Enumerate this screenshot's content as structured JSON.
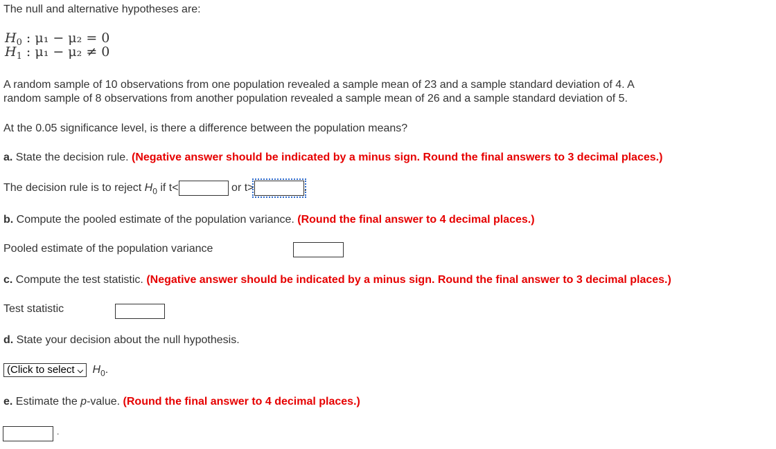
{
  "intro": "The null and alternative hypotheses are:",
  "h0": {
    "label": "H",
    "sub": "0",
    "expr": ": μ₁ − μ₂ = 0"
  },
  "h1": {
    "label": "H",
    "sub": "1",
    "expr": ": μ₁ − μ₂ ≠ 0"
  },
  "problem_line1": "A random sample of 10 observations from one population revealed a sample mean of 23 and a sample standard deviation of 4. A",
  "problem_line2": "random sample of 8 observations from another population revealed a sample mean of 26 and a sample standard deviation of 5.",
  "question": "At the 0.05 significance level, is there a difference between the population means?",
  "part_a": {
    "letter": "a.",
    "text": " State the decision rule. ",
    "note": "(Negative answer should be indicated by a minus sign. Round the final answers to 3 decimal places.)",
    "rule_prefix": "The decision rule is to reject ",
    "h": "H",
    "h_sub": "0",
    "if_t_lt": " if t<",
    "or_t_gt": "or t>",
    "suffix": "."
  },
  "part_b": {
    "letter": "b.",
    "text": " Compute the pooled estimate of the population variance. ",
    "note": "(Round the final answer to 4 decimal places.)",
    "field_label": "Pooled estimate of the population variance"
  },
  "part_c": {
    "letter": "c.",
    "text": " Compute the test statistic. ",
    "note": "(Negative answer should be indicated by a minus sign. Round the final answer to 3 decimal places.)",
    "field_label": "Test statistic"
  },
  "part_d": {
    "letter": "d.",
    "text": " State your decision about the null hypothesis.",
    "select_value": "(Click to select",
    "h": "H",
    "h_sub": "0",
    "suffix": "."
  },
  "part_e": {
    "letter": "e.",
    "text": " Estimate the ",
    "p": "p",
    "text2": "-value. ",
    "note": "(Round the final answer to 4 decimal places.)",
    "suffix": "."
  }
}
